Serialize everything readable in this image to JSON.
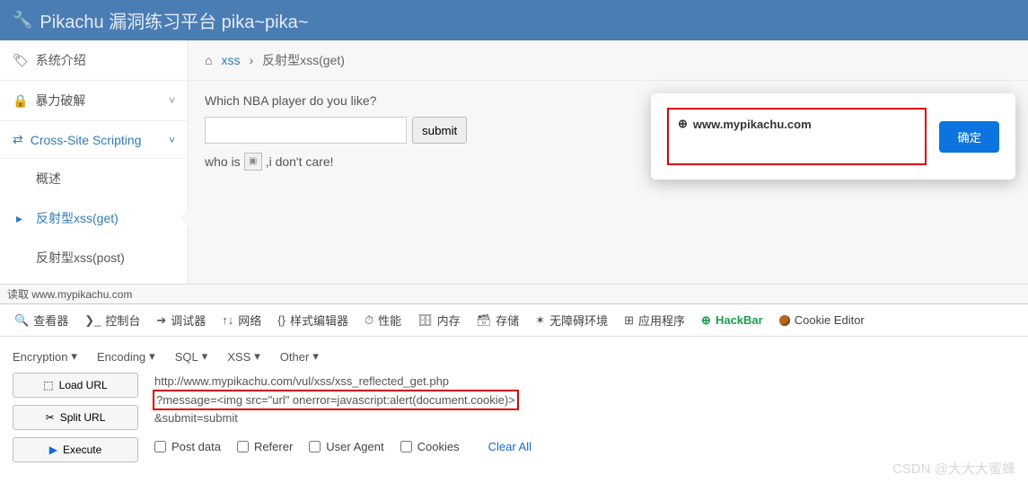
{
  "header": {
    "title": "Pikachu 漏洞练习平台 pika~pika~"
  },
  "sidebar": {
    "items": [
      {
        "icon": "🏷",
        "label": "系统介绍",
        "chev": ""
      },
      {
        "icon": "🔒",
        "label": "暴力破解",
        "chev": "˅"
      },
      {
        "icon": "⇄",
        "label": "Cross-Site Scripting",
        "chev": "˅",
        "blue": true
      }
    ],
    "subs": [
      {
        "label": "概述"
      },
      {
        "label": "反射型xss(get)",
        "active": true
      },
      {
        "label": "反射型xss(post)"
      }
    ]
  },
  "breadcrumb": {
    "home_icon": "⌂",
    "link": "xss",
    "sep": "›",
    "current": "反射型xss(get)"
  },
  "content": {
    "question": "Which NBA player do you like?",
    "submit": "submit",
    "result_prefix": "who is ",
    "result_suffix": ",i don't care!"
  },
  "statusbar": {
    "text": "读取 www.mypikachu.com"
  },
  "alert": {
    "domain": "www.mypikachu.com",
    "ok": "确定"
  },
  "devtabs": [
    {
      "icon": "🔍",
      "label": "查看器"
    },
    {
      "icon": "❯_",
      "label": "控制台"
    },
    {
      "icon": "➔",
      "label": "调试器"
    },
    {
      "icon": "↑↓",
      "label": "网络"
    },
    {
      "icon": "{}",
      "label": "样式编辑器"
    },
    {
      "icon": "⏱",
      "label": "性能"
    },
    {
      "icon": "🗄",
      "label": "内存"
    },
    {
      "icon": "🗃",
      "label": "存储"
    },
    {
      "icon": "✶",
      "label": "无障碍环境"
    },
    {
      "icon": "⊞",
      "label": "应用程序"
    },
    {
      "icon": "⊕",
      "label": "HackBar",
      "hack": true
    },
    {
      "icon": "",
      "label": "Cookie Editor",
      "cookie": true
    }
  ],
  "hackbar": {
    "menus": [
      "Encryption",
      "Encoding",
      "SQL",
      "XSS",
      "Other"
    ],
    "buttons": [
      {
        "icon": "⬚",
        "label": "Load URL"
      },
      {
        "icon": "✂",
        "label": "Split URL"
      },
      {
        "icon": "▶",
        "label": "Execute"
      }
    ],
    "url_lines": [
      "http://www.mypikachu.com/vul/xss/xss_reflected_get.php",
      "?message=<img src=\"url\" onerror=javascript:alert(document.cookie)>",
      "&submit=submit"
    ],
    "checks": [
      "Post data",
      "Referer",
      "User Agent",
      "Cookies"
    ],
    "clear": "Clear All"
  },
  "watermark": "CSDN @大大大蜜蜂"
}
